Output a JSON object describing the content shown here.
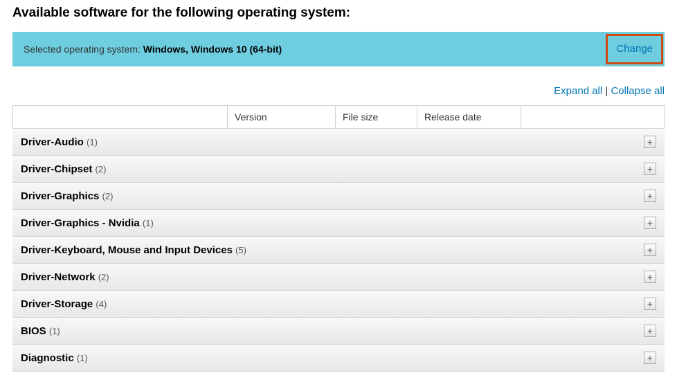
{
  "title": "Available software for the following operating system:",
  "osBanner": {
    "label": "Selected operating system: ",
    "value": "Windows, Windows 10 (64-bit)",
    "changeLabel": "Change"
  },
  "controls": {
    "expandAll": "Expand all",
    "collapseAll": "Collapse all",
    "divider": " | "
  },
  "tableHeaders": {
    "version": "Version",
    "fileSize": "File size",
    "releaseDate": "Release date"
  },
  "categories": [
    {
      "name": "Driver-Audio",
      "count": "(1)"
    },
    {
      "name": "Driver-Chipset",
      "count": "(2)"
    },
    {
      "name": "Driver-Graphics",
      "count": "(2)"
    },
    {
      "name": "Driver-Graphics - Nvidia",
      "count": "(1)"
    },
    {
      "name": "Driver-Keyboard, Mouse and Input Devices",
      "count": "(5)"
    },
    {
      "name": "Driver-Network",
      "count": "(2)"
    },
    {
      "name": "Driver-Storage",
      "count": "(4)"
    },
    {
      "name": "BIOS",
      "count": "(1)"
    },
    {
      "name": "Diagnostic",
      "count": "(1)"
    }
  ],
  "plusSymbol": "+"
}
